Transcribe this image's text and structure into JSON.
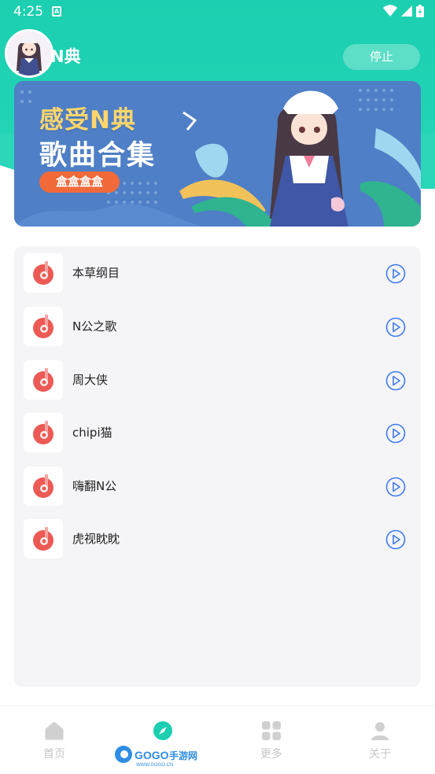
{
  "status_bar": {
    "time": "4:25",
    "notification_glyph": "A"
  },
  "header": {
    "title": "N典",
    "stop_label": "停止"
  },
  "banner": {
    "line1": "感受N典",
    "line2": "歌曲合集",
    "tag": "盒盒盒盒"
  },
  "songs": [
    {
      "title": "本草纲目"
    },
    {
      "title": "N公之歌"
    },
    {
      "title": "周大侠"
    },
    {
      "title": "chipi猫"
    },
    {
      "title": "嗨翻N公"
    },
    {
      "title": "虎视眈眈"
    }
  ],
  "nav": [
    {
      "label": "首页",
      "icon": "home-icon"
    },
    {
      "label": "",
      "icon": "compass-icon",
      "active": true
    },
    {
      "label": "更多",
      "icon": "grid-icon"
    },
    {
      "label": "关于",
      "icon": "person-icon"
    }
  ],
  "watermark": {
    "brand": "GOGO手游网",
    "url": "WWW.GOGO.CN"
  },
  "colors": {
    "accent": "#1ccfb0",
    "banner_bg": "#4f7fc6",
    "banner_yellow": "#ffd66b",
    "tag_orange": "#f26a3a",
    "music_red": "#ec5a55",
    "play_blue": "#3d7bf2"
  }
}
